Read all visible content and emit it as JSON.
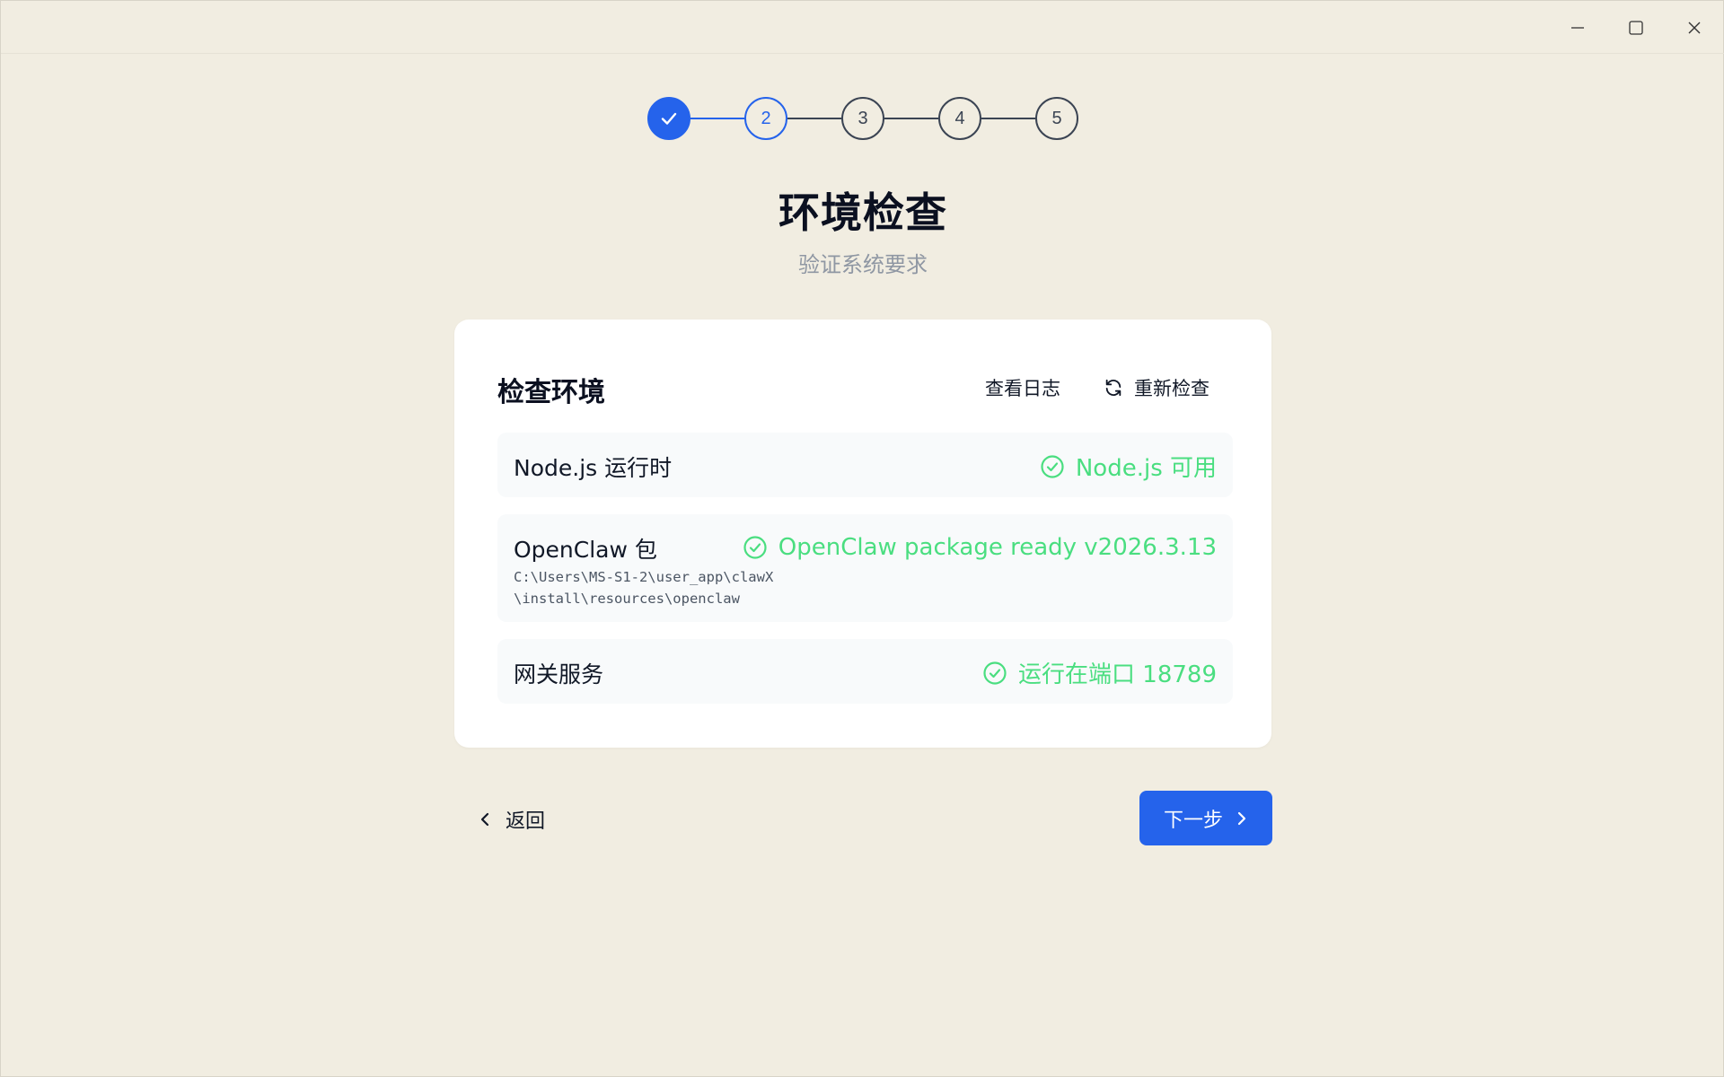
{
  "window": {
    "controls": [
      "minimize-icon",
      "maximize-icon",
      "close-icon"
    ]
  },
  "stepper": {
    "steps": [
      {
        "label": "",
        "state": "done",
        "icon": "check-icon"
      },
      {
        "label": "2",
        "state": "active"
      },
      {
        "label": "3",
        "state": "pending"
      },
      {
        "label": "4",
        "state": "pending"
      },
      {
        "label": "5",
        "state": "pending"
      }
    ]
  },
  "header": {
    "title": "环境检查",
    "subtitle": "验证系统要求"
  },
  "card": {
    "title": "检查环境",
    "view_logs_label": "查看日志",
    "recheck_label": "重新检查",
    "checks": [
      {
        "label": "Node.js 运行时",
        "status": "Node.js 可用",
        "icon": "check-circle-icon"
      },
      {
        "label": "OpenClaw 包",
        "path": "C:\\Users\\MS-S1-2\\user_app\\clawX\\install\\resources\\openclaw",
        "status": "OpenClaw package ready v2026.3.13",
        "icon": "check-circle-icon"
      },
      {
        "label": "网关服务",
        "status": "运行在端口 18789",
        "icon": "check-circle-icon"
      }
    ]
  },
  "footer": {
    "back_label": "返回",
    "next_label": "下一步"
  },
  "colors": {
    "background": "#f1ede1",
    "accent": "#2563eb",
    "success": "#4ade80",
    "card": "#ffffff",
    "row": "#f8fafb"
  }
}
